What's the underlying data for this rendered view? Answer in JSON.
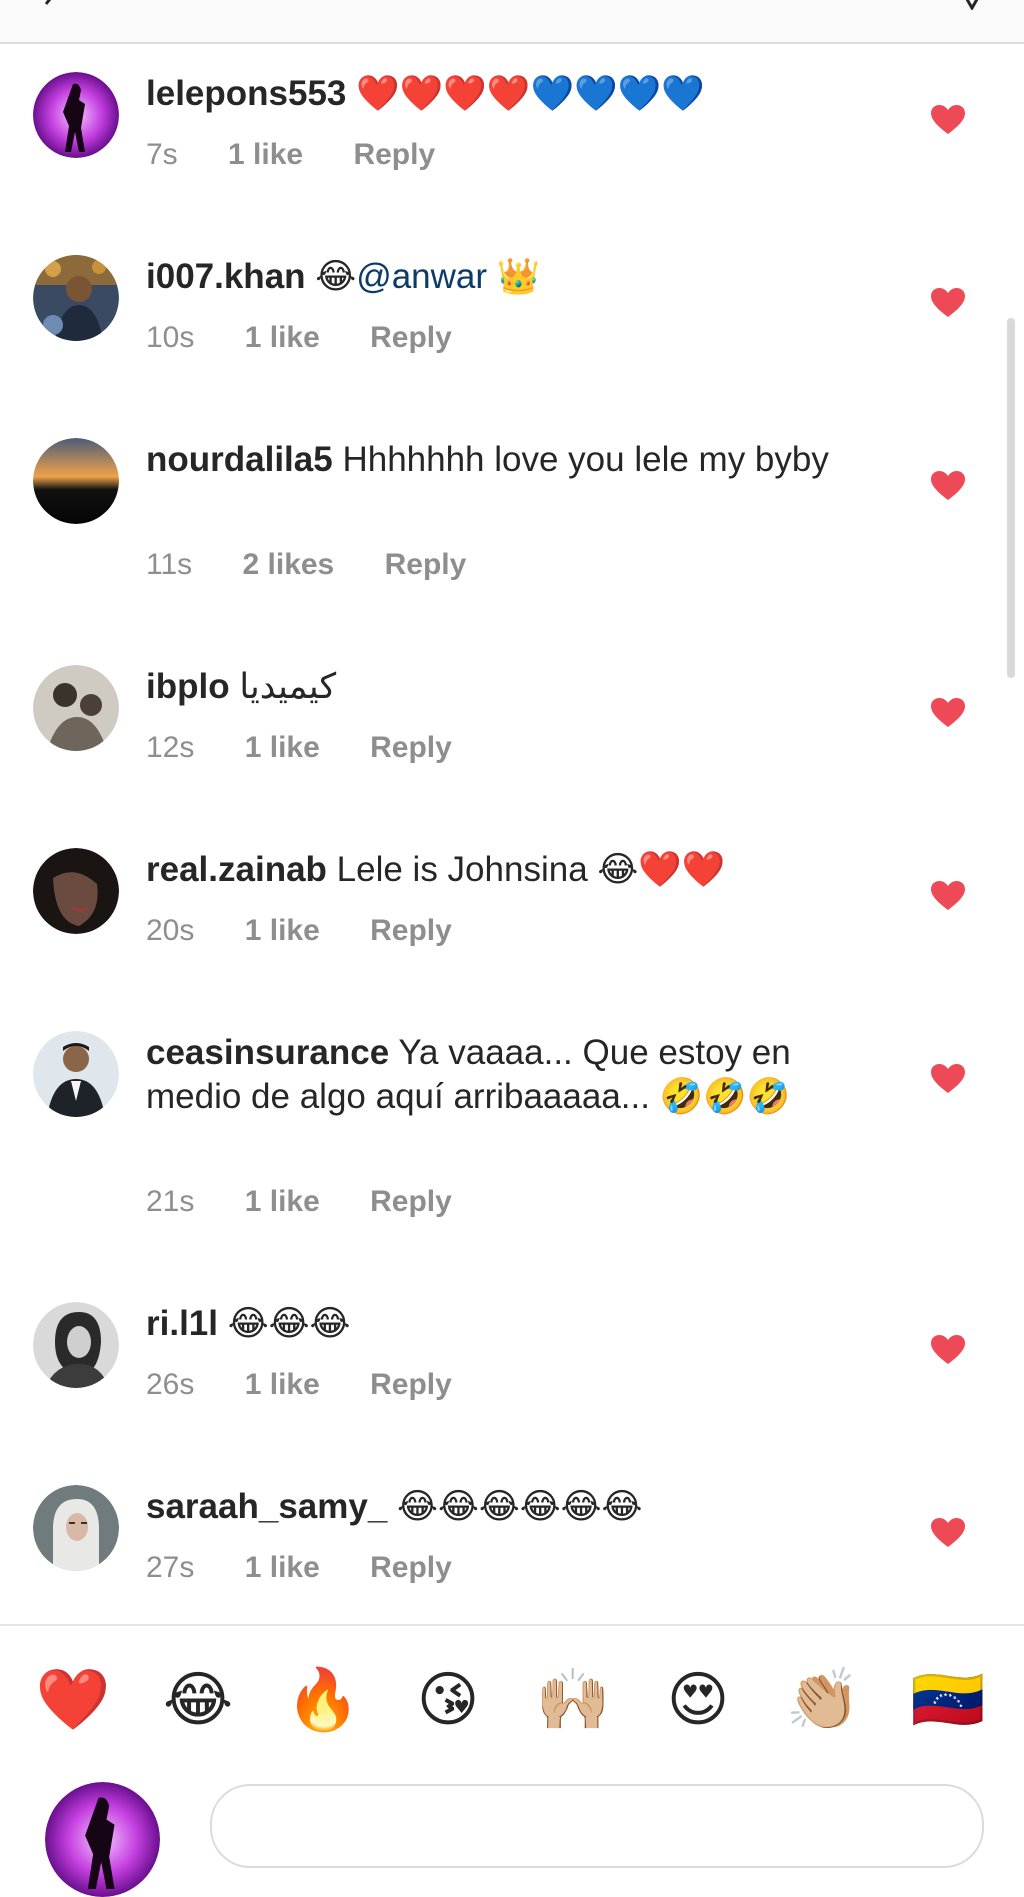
{
  "comments": [
    {
      "username": "lelepons553",
      "text": "",
      "emojis": "❤️❤️❤️❤️💙💙💙💙",
      "time": "7s",
      "likes": "1 like",
      "reply": "Reply"
    },
    {
      "username": "i007.khan",
      "text": "😂",
      "mention": "@anwar",
      "emojis": " 👑",
      "time": "10s",
      "likes": "1 like",
      "reply": "Reply"
    },
    {
      "username": "nourdalila5",
      "text": "Hhhhhhh love you lele my byby",
      "time": "11s",
      "likes": "2 likes",
      "reply": "Reply"
    },
    {
      "username": "ibplo",
      "text": "كيميديا",
      "time": "12s",
      "likes": "1 like",
      "reply": "Reply"
    },
    {
      "username": "real.zainab",
      "text": "Lele is Johnsina 😂❤️❤️",
      "time": "20s",
      "likes": "1 like",
      "reply": "Reply"
    },
    {
      "username": "ceasinsurance",
      "text": "Ya vaaaa... Que estoy en medio de algo aquí arribaaaaa... 🤣🤣🤣",
      "time": "21s",
      "likes": "1 like",
      "reply": "Reply"
    },
    {
      "username": "ri.l1l",
      "text": "😂😂😂",
      "time": "26s",
      "likes": "1 like",
      "reply": "Reply"
    },
    {
      "username": "saraah_samy_",
      "text": "😂😂😂😂😂😂",
      "time": "27s",
      "likes": "1 like",
      "reply": "Reply"
    }
  ],
  "quick_reactions": [
    "❤️",
    "😂",
    "🔥",
    "😘",
    "🙌🏼",
    "😍",
    "👏🏼",
    "🇻🇪"
  ],
  "colors": {
    "like_heart": "#ed4956",
    "meta_text": "#8e8e8e",
    "mention": "#0d3a66"
  }
}
